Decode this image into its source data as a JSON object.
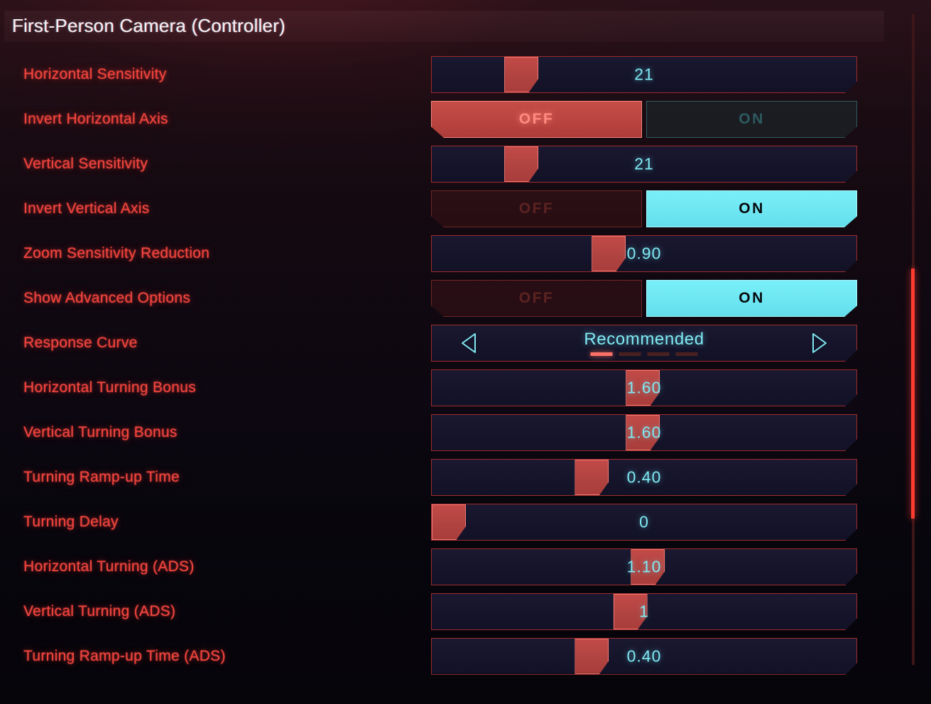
{
  "header": {
    "title": "First-Person Camera (Controller)"
  },
  "toggle_labels": {
    "off": "OFF",
    "on": "ON"
  },
  "stepper_icons": {
    "prev": "chevron-left-icon",
    "next": "chevron-right-icon"
  },
  "scrollbar": {
    "orientation": "vertical",
    "thumb_top_pct": 39,
    "thumb_height_pct": 38
  },
  "rows": [
    {
      "label": "Horizontal Sensitivity",
      "type": "slider",
      "value": "21",
      "fill_pct": 18.5
    },
    {
      "label": "Invert Horizontal Axis",
      "type": "toggle",
      "value": "OFF"
    },
    {
      "label": "Vertical Sensitivity",
      "type": "slider",
      "value": "21",
      "fill_pct": 18.5
    },
    {
      "label": "Invert Vertical Axis",
      "type": "toggle",
      "value": "ON"
    },
    {
      "label": "Zoom Sensitivity Reduction",
      "type": "slider",
      "value": "0.90",
      "fill_pct": 40.8
    },
    {
      "label": "Show Advanced Options",
      "type": "toggle",
      "value": "ON"
    },
    {
      "label": "Response Curve",
      "type": "stepper",
      "value": "Recommended",
      "page_count": 4,
      "page_index": 0
    },
    {
      "label": "Horizontal Turning Bonus",
      "type": "slider",
      "value": "1.60",
      "fill_pct": 49.5
    },
    {
      "label": "Vertical Turning Bonus",
      "type": "slider",
      "value": "1.60",
      "fill_pct": 49.5
    },
    {
      "label": "Turning Ramp-up Time",
      "type": "slider",
      "value": "0.40",
      "fill_pct": 36.5
    },
    {
      "label": "Turning Delay",
      "type": "slider",
      "value": "0",
      "fill_pct": 0
    },
    {
      "label": "Horizontal Turning (ADS)",
      "type": "slider",
      "value": "1.10",
      "fill_pct": 50.8
    },
    {
      "label": "Vertical Turning (ADS)",
      "type": "slider",
      "value": "1",
      "fill_pct": 46.3
    },
    {
      "label": "Turning Ramp-up Time (ADS)",
      "type": "slider",
      "value": "0.40",
      "fill_pct": 36.5
    }
  ]
}
